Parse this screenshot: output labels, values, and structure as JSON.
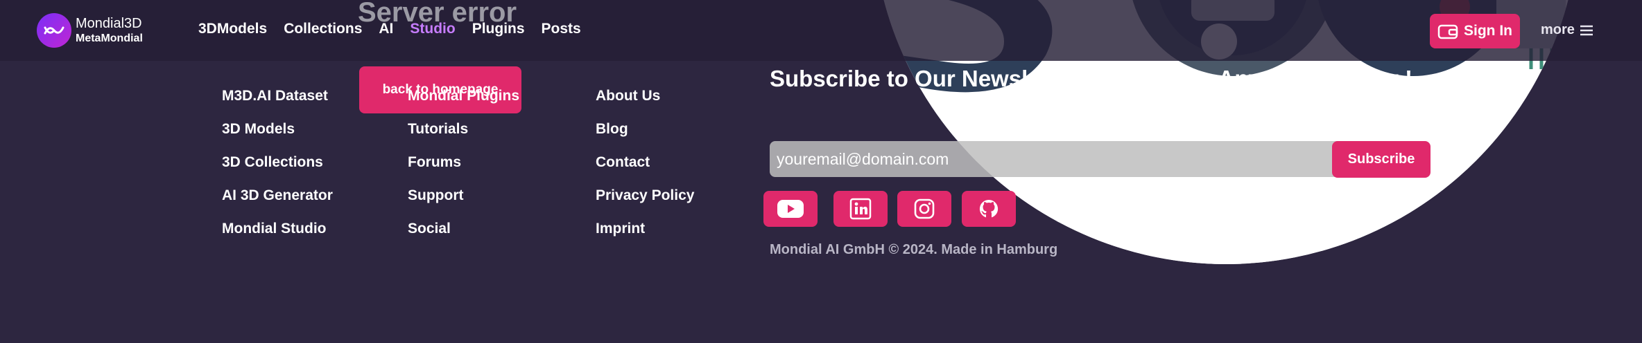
{
  "brand": {
    "name": "Mondial3D",
    "sub": "MetaMondial"
  },
  "nav": {
    "links": [
      "3DModels",
      "Collections",
      "AI",
      "Studio",
      "Plugins",
      "Posts"
    ],
    "active": "Studio",
    "sign_in": "Sign In",
    "more": "more"
  },
  "error": {
    "title": "Server error",
    "back_button": "back to homepage"
  },
  "footer": {
    "col1": [
      "M3D.AI Dataset",
      "3D Models",
      "3D Collections",
      "AI 3D Generator",
      "Mondial Studio"
    ],
    "col2": [
      "Mondial Plugins",
      "Tutorials",
      "Forums",
      "Support",
      "Social"
    ],
    "col3": [
      "About Us",
      "Blog",
      "Contact",
      "Privacy Policy",
      "Imprint"
    ]
  },
  "newsletter": {
    "title": "Subscribe to Our Newsletter - Don't Miss Any Opportunity !",
    "email_value": "youremail@domain.com",
    "subscribe": "Subscribe"
  },
  "social": [
    "youtube-icon",
    "linkedin-icon",
    "instagram-icon",
    "github-icon"
  ],
  "copyright": "Mondial AI GmbH © 2024. Made in Hamburg",
  "colors": {
    "background": "#2d2640",
    "accent": "#e0296b",
    "active_link": "#c77dff"
  }
}
